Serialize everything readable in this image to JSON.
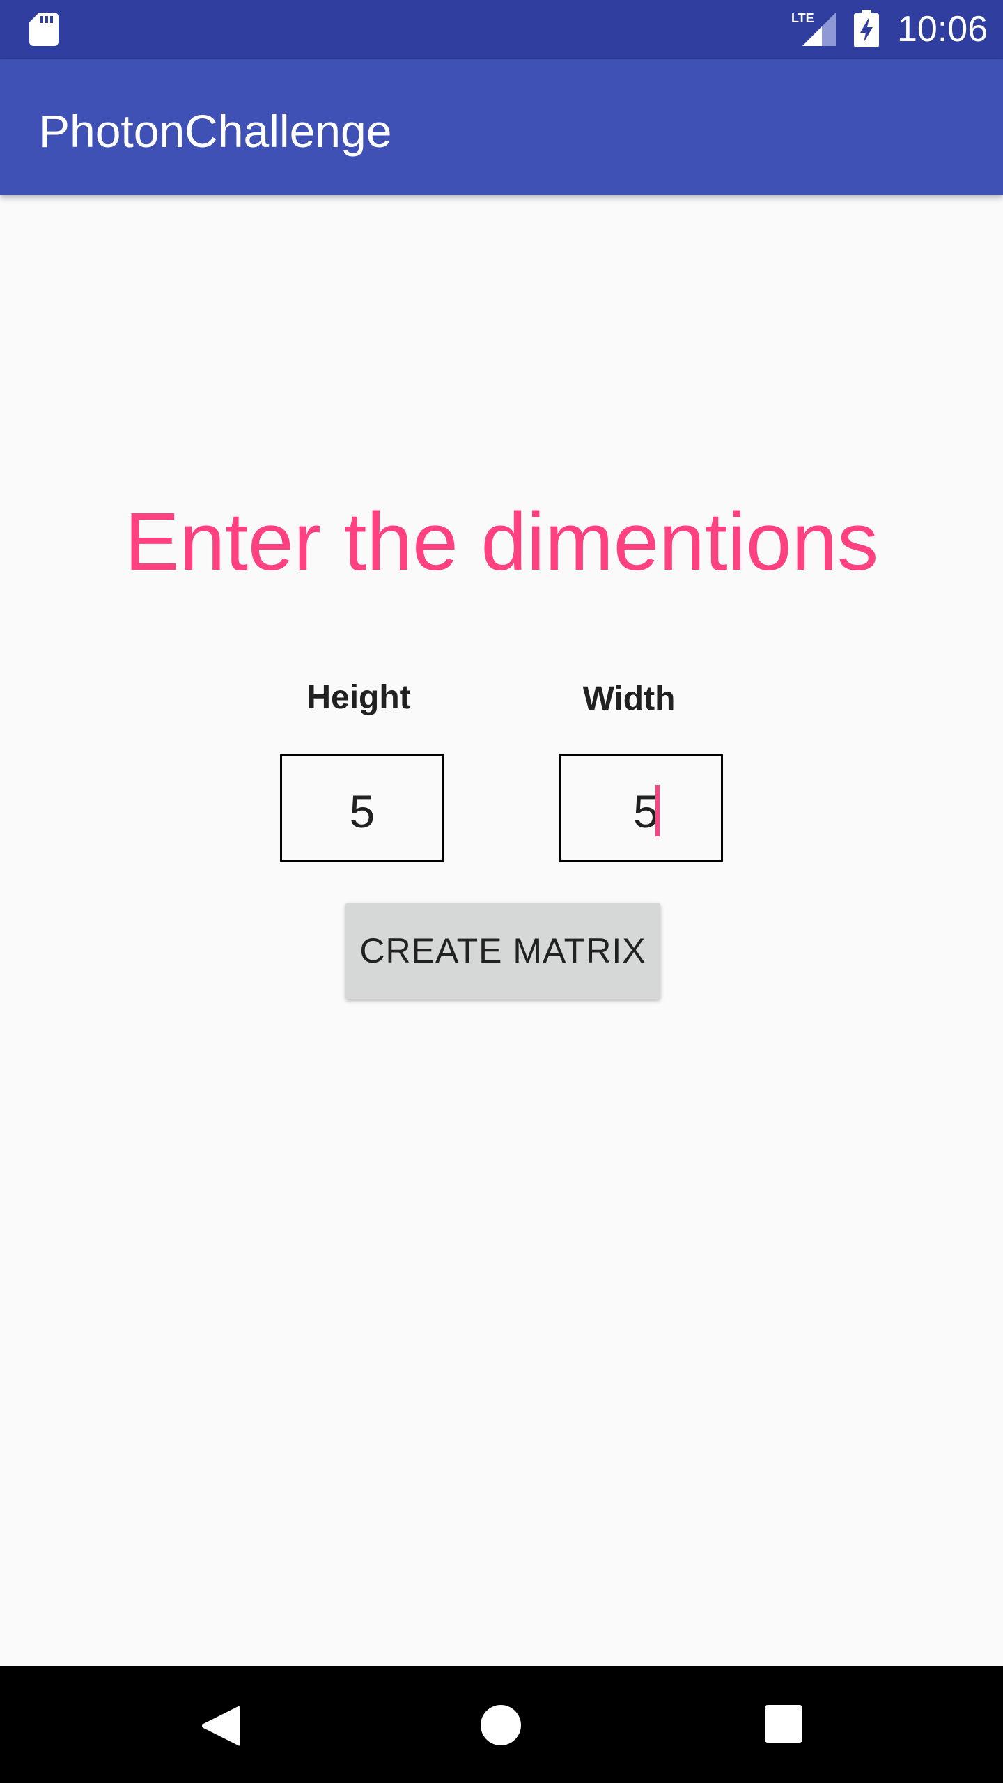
{
  "status_bar": {
    "time": "10:06",
    "network_label": "LTE",
    "icons": [
      "sd-card-icon",
      "lte-signal-icon",
      "battery-charging-icon"
    ]
  },
  "app_bar": {
    "title": "PhotonChallenge"
  },
  "main": {
    "heading": "Enter the dimentions",
    "height": {
      "label": "Height",
      "value": "5"
    },
    "width": {
      "label": "Width",
      "value": "5"
    },
    "create_button_label": "CREATE MATRIX"
  },
  "navigation": {
    "icons": [
      "back-icon",
      "home-icon",
      "recent-apps-icon"
    ]
  },
  "colors": {
    "primary": "#3F51B5",
    "primary_dark": "#303F9F",
    "accent": "#FF4081",
    "background": "#FAFAFA",
    "button": "#D6D7D7"
  }
}
